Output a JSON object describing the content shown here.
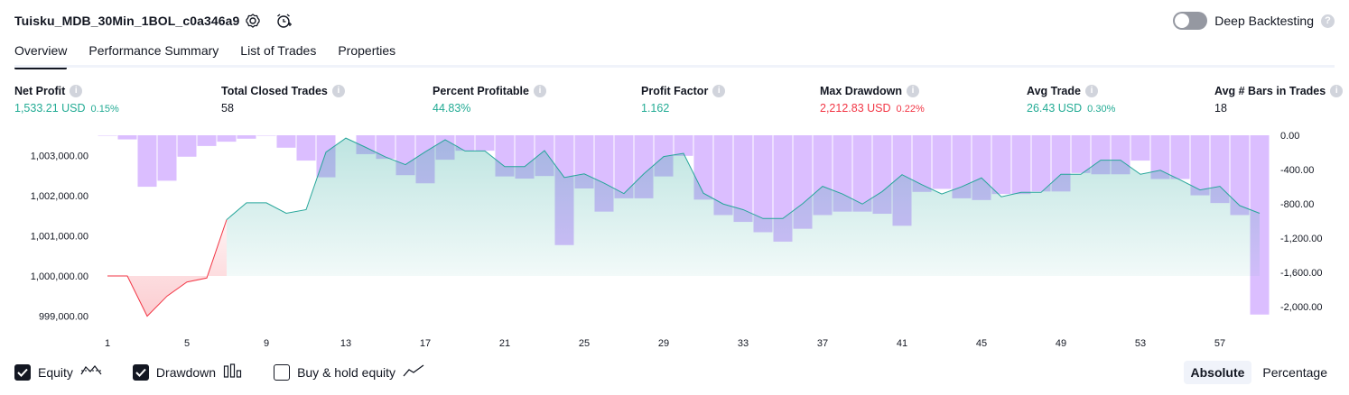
{
  "header": {
    "title": "Tuisku_MDB_30Min_1BOL_c0a346a9",
    "deep_backtesting_label": "Deep Backtesting",
    "deep_backtesting_on": false
  },
  "tabs": [
    {
      "label": "Overview",
      "active": true
    },
    {
      "label": "Performance Summary",
      "active": false
    },
    {
      "label": "List of Trades",
      "active": false
    },
    {
      "label": "Properties",
      "active": false
    }
  ],
  "metrics": [
    {
      "label": "Net Profit",
      "value": "1,533.21 USD",
      "pct": "0.15%",
      "color": "#22ab94"
    },
    {
      "label": "Total Closed Trades",
      "value": "58",
      "pct": "",
      "color": "#131722"
    },
    {
      "label": "Percent Profitable",
      "value": "44.83%",
      "pct": "",
      "color": "#22ab94"
    },
    {
      "label": "Profit Factor",
      "value": "1.162",
      "pct": "",
      "color": "#22ab94"
    },
    {
      "label": "Max Drawdown",
      "value": "2,212.83 USD",
      "pct": "0.22%",
      "color": "#f23645"
    },
    {
      "label": "Avg Trade",
      "value": "26.43 USD",
      "pct": "0.30%",
      "color": "#22ab94"
    },
    {
      "label": "Avg # Bars in Trades",
      "value": "18",
      "pct": "",
      "color": "#131722"
    }
  ],
  "chart_data": {
    "type": "line",
    "x": [
      1,
      2,
      3,
      4,
      5,
      6,
      7,
      8,
      9,
      10,
      11,
      12,
      13,
      14,
      15,
      16,
      17,
      18,
      19,
      20,
      21,
      22,
      23,
      24,
      25,
      26,
      27,
      28,
      29,
      30,
      31,
      32,
      33,
      34,
      35,
      36,
      37,
      38,
      39,
      40,
      41,
      42,
      43,
      44,
      45,
      46,
      47,
      48,
      49,
      50,
      51,
      52,
      53,
      54,
      55,
      56,
      57,
      58,
      59
    ],
    "x_ticks": [
      "1",
      "5",
      "9",
      "13",
      "17",
      "21",
      "25",
      "29",
      "33",
      "37",
      "41",
      "45",
      "49",
      "53",
      "57"
    ],
    "series": [
      {
        "type": "line",
        "axis": "left",
        "values": [
          1000000,
          1000000,
          999000,
          999500,
          999850,
          999950,
          1001400,
          1001820,
          1001820,
          1001560,
          1001650,
          1003080,
          1003430,
          1003200,
          1002960,
          1002770,
          1003090,
          1003390,
          1003110,
          1003110,
          1002720,
          1002720,
          1003120,
          1002450,
          1002540,
          1002310,
          1002050,
          1002540,
          1002970,
          1003050,
          1002060,
          1001790,
          1001650,
          1001430,
          1001430,
          1001800,
          1002230,
          1002040,
          1001790,
          1002100,
          1002520,
          1002270,
          1002040,
          1002220,
          1002440,
          1001970,
          1002080,
          1002080,
          1002530,
          1002530,
          1002880,
          1002880,
          1002530,
          1002630,
          1002390,
          1002140,
          1002230,
          1001750,
          1001560
        ]
      },
      {
        "type": "bar",
        "axis": "right",
        "values": [
          -5,
          -48,
          -600,
          -530,
          -250,
          -125,
          -75,
          -40,
          -5,
          -145,
          -295,
          -490,
          0,
          -220,
          -275,
          -465,
          -560,
          -285,
          -180,
          -180,
          -480,
          -505,
          -475,
          -1280,
          -620,
          -890,
          -735,
          -735,
          -480,
          -240,
          -750,
          -930,
          -1010,
          -1130,
          -1240,
          -1090,
          -930,
          -890,
          -890,
          -915,
          -1055,
          -660,
          -625,
          -735,
          -755,
          -685,
          -685,
          -655,
          -655,
          -440,
          -455,
          -455,
          -295,
          -510,
          -510,
          -700,
          -790,
          -930,
          -2090
        ]
      }
    ],
    "ylim_left": [
      998700,
      1003500
    ],
    "yticks_left": [
      "1,003,000.00",
      "1,002,000.00",
      "1,001,000.00",
      "1,000,000.00",
      "999,000.00"
    ],
    "ylim_right": [
      -2250,
      0
    ],
    "yticks_right": [
      "0.00",
      "-400.00",
      "-800.00",
      "-1,200.00",
      "-1,600.00",
      "-2,000.00"
    ],
    "colors": {
      "equity_line_positive": "#26a69a",
      "equity_line_negative": "#f23645",
      "drawdown_bar": "#c79bff"
    }
  },
  "legend": [
    {
      "label": "Equity",
      "checked": true,
      "icon": "equity-line-icon"
    },
    {
      "label": "Drawdown",
      "checked": true,
      "icon": "drawdown-bars-icon"
    },
    {
      "label": "Buy & hold equity",
      "checked": false,
      "icon": "buy-hold-line-icon"
    }
  ],
  "mode": {
    "absolute": "Absolute",
    "percentage": "Percentage",
    "selected": "absolute"
  }
}
